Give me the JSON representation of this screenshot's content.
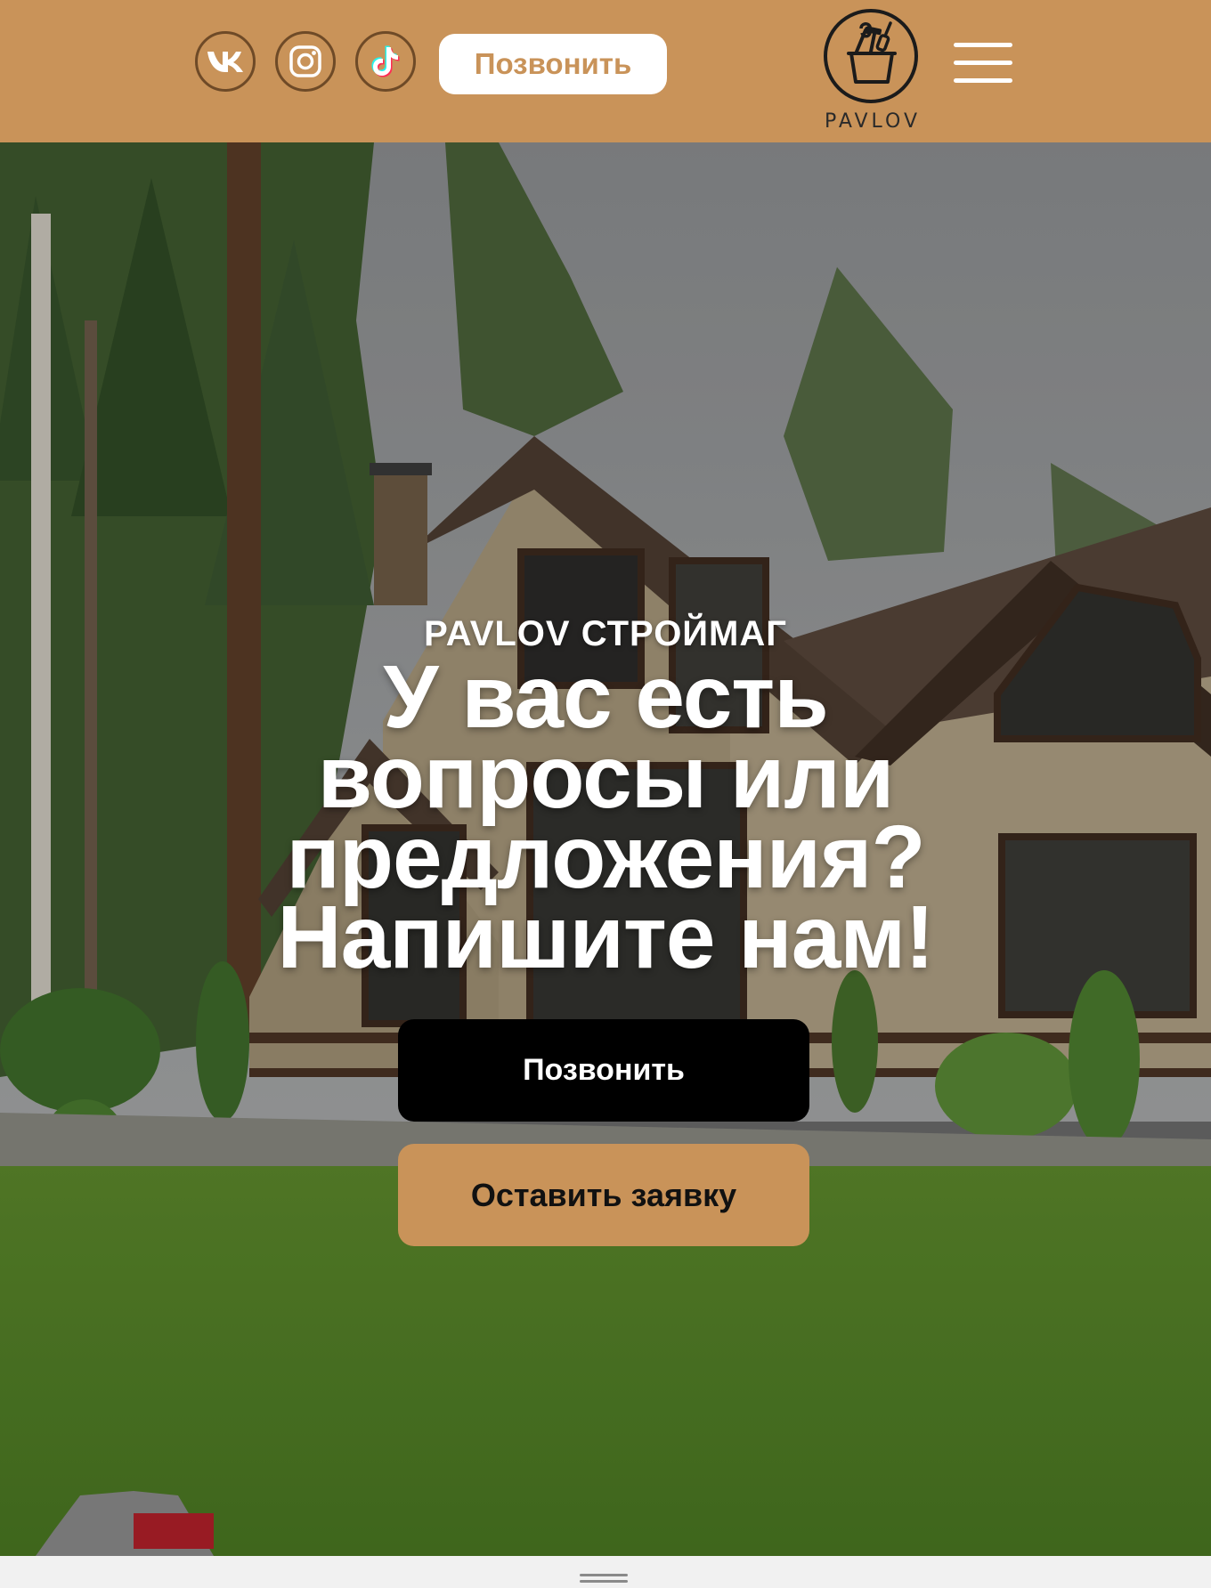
{
  "header": {
    "background_color": "#c99359",
    "social": [
      {
        "name": "vk",
        "icon": "vk-icon"
      },
      {
        "name": "instagram",
        "icon": "instagram-icon"
      },
      {
        "name": "tiktok",
        "icon": "tiktok-icon"
      }
    ],
    "call_label": "Позвонить",
    "logo_text": "PAVLOV",
    "menu_icon": "hamburger-menu-icon"
  },
  "hero": {
    "subtitle": "PAVLOV СТРОЙМАГ",
    "title_lines": [
      "У вас есть",
      "вопросы или",
      "предложения?",
      "Напишите нам!"
    ],
    "call_button": "Позвонить",
    "request_button": "Оставить заявку",
    "accent_color": "#c99359",
    "primary_button_color": "#000000"
  },
  "bottom_bar": {
    "handle_icon": "drag-handle-icon"
  }
}
